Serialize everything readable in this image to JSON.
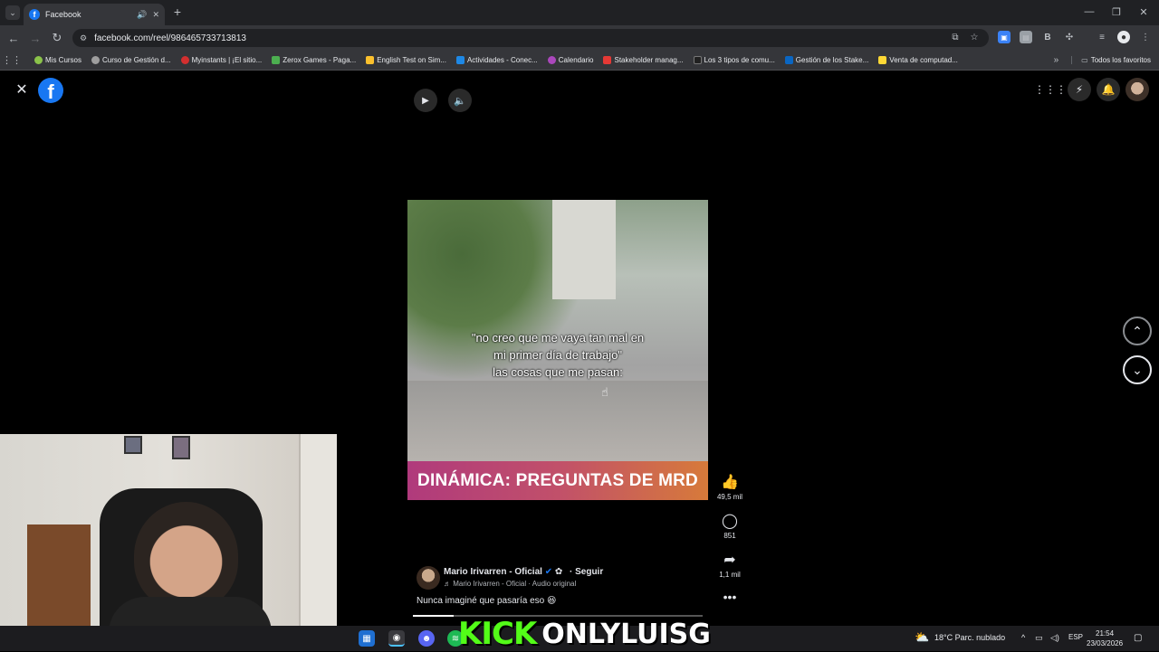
{
  "browser": {
    "tab_title": "Facebook",
    "url": "facebook.com/reel/986465733713813",
    "bookmarks": [
      {
        "label": "Mis Cursos",
        "color": "#8bc34a"
      },
      {
        "label": "Curso de Gestión d...",
        "color": "#9e9e9e"
      },
      {
        "label": "Myinstants | ¡El sitio...",
        "color": "#d32f2f"
      },
      {
        "label": "Zerox Games - Paga...",
        "color": "#4caf50"
      },
      {
        "label": "English Test on Sim...",
        "color": "#fbc02d"
      },
      {
        "label": "Actividades - Conec...",
        "color": "#1e88e5"
      },
      {
        "label": "Calendario",
        "color": "#ab47bc"
      },
      {
        "label": "Stakeholder manag...",
        "color": "#e53935"
      },
      {
        "label": "Los 3 tipos de comu...",
        "color": "#212121"
      },
      {
        "label": "Gestión de los Stake...",
        "color": "#0a66c2"
      },
      {
        "label": "Venta de computad...",
        "color": "#fdd835"
      }
    ],
    "all_bookmarks": "Todos los favoritos"
  },
  "reel": {
    "caption_lines": [
      "\"no creo que me vaya tan mal en",
      "mi primer día de trabajo\"",
      "las cosas que me pasan:"
    ],
    "banner": "DINÁMICA: PREGUNTAS DE MRD",
    "likes": "49,5 mil",
    "comments": "851",
    "shares": "1,1 mil",
    "author": "Mario Irivarren - Oficial",
    "follow": "· Seguir",
    "audio": "♬ Mario Irivarren - Oficial · Audio original",
    "description": "Nunca imaginé que pasaría eso 😆",
    "progress": 0.14
  },
  "overlay": {
    "kick": "KICK",
    "channel": "ONLYLUISG"
  },
  "taskbar": {
    "weather": "18°C  Parc. nublado",
    "lang": "ESP",
    "time": "21:54",
    "date": "23/03/2026"
  }
}
